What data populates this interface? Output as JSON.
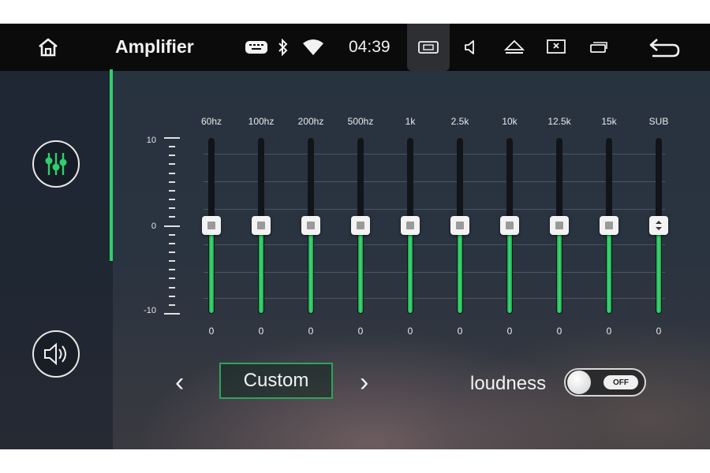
{
  "statusbar": {
    "title": "Amplifier",
    "time": "04:39",
    "icons": [
      "home-icon",
      "keyboard-icon",
      "bluetooth-icon",
      "wifi-icon",
      "screenshot-icon",
      "volume-icon",
      "eject-icon",
      "close-window-icon",
      "multitask-icon",
      "back-icon"
    ]
  },
  "sidebar": {
    "items": [
      {
        "name": "equalizer-icon",
        "selected": true
      },
      {
        "name": "speaker-icon",
        "selected": false
      }
    ]
  },
  "equalizer": {
    "scale_max": "10",
    "scale_mid": "0",
    "scale_min": "-10",
    "bands": [
      {
        "label": "60hz",
        "value": "0"
      },
      {
        "label": "100hz",
        "value": "0"
      },
      {
        "label": "200hz",
        "value": "0"
      },
      {
        "label": "500hz",
        "value": "0"
      },
      {
        "label": "1k",
        "value": "0"
      },
      {
        "label": "2.5k",
        "value": "0"
      },
      {
        "label": "10k",
        "value": "0"
      },
      {
        "label": "12.5k",
        "value": "0"
      },
      {
        "label": "15k",
        "value": "0"
      },
      {
        "label": "SUB",
        "value": "0"
      }
    ]
  },
  "preset": {
    "prev_label": "‹",
    "name": "Custom",
    "next_label": "›"
  },
  "loudness": {
    "label": "loudness",
    "state": "OFF"
  },
  "colors": {
    "accent": "#2fcf6b",
    "statusbar_bg": "#0b0b0c",
    "preset_border": "#2fa35a"
  }
}
